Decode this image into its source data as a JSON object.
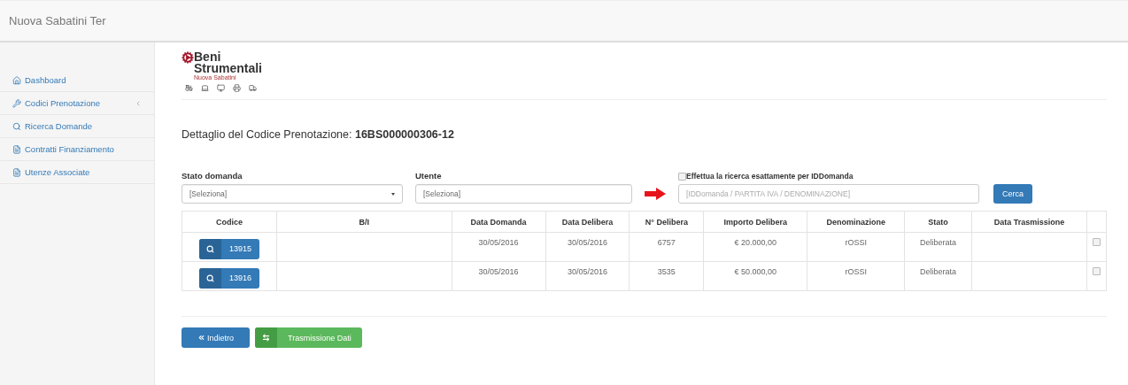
{
  "app_title": "Nuova Sabatini Ter",
  "sidebar": {
    "items": [
      {
        "kind": "home",
        "label": "Dashboard",
        "has_submenu": false
      },
      {
        "kind": "wrench",
        "label": "Codici Prenotazione",
        "has_submenu": true
      },
      {
        "kind": "search",
        "label": "Ricerca Domande",
        "has_submenu": false
      },
      {
        "kind": "file",
        "label": "Contratti Finanziamento",
        "has_submenu": false
      },
      {
        "kind": "file",
        "label": "Utenze Associate",
        "has_submenu": false
      }
    ]
  },
  "logo": {
    "line_1": "Beni",
    "line_2": "Strumentali",
    "subtitle": "Nuova Sabatini"
  },
  "heading": "Dettaglio del Codice Prenotazione: **16BS000000306-12**",
  "filters": {
    "stato_domanda": {
      "label": "Stato domanda",
      "value": "[Seleziona]"
    },
    "utente": {
      "label": "Utente",
      "value": "[Seleziona]"
    },
    "exact_search": {
      "label": "Effettua la ricerca esattamente per IDDomanda",
      "checked": false
    },
    "search": {
      "placeholder": "[IDDomanda / PARTITA IVA / DENOMINAZIONE]"
    },
    "search_button": "Cerca"
  },
  "table": {
    "columns": [
      "Codice",
      "B/I",
      "Data Domanda",
      "Data Delibera",
      "N° Delibera",
      "Importo Delibera",
      "Denominazione",
      "Stato",
      "Data Trasmissione"
    ],
    "rows": [
      {
        "codice": "13915",
        "bi": "",
        "data_domanda": "30/05/2016",
        "data_delibera": "30/05/2016",
        "n_delibera": "6757",
        "importo": "€ 20.000,00",
        "denominazione": "rOSSI",
        "stato": "Deliberata",
        "data_trasmissione": "",
        "checked": false
      },
      {
        "codice": "13916",
        "bi": "",
        "data_domanda": "30/05/2016",
        "data_delibera": "30/05/2016",
        "n_delibera": "3535",
        "importo": "€ 50.000,00",
        "denominazione": "rOSSI",
        "stato": "Deliberata",
        "data_trasmissione": "",
        "checked": false
      }
    ]
  },
  "buttons": {
    "back": "Indietro",
    "transmit": "Trasmissione Dati"
  }
}
